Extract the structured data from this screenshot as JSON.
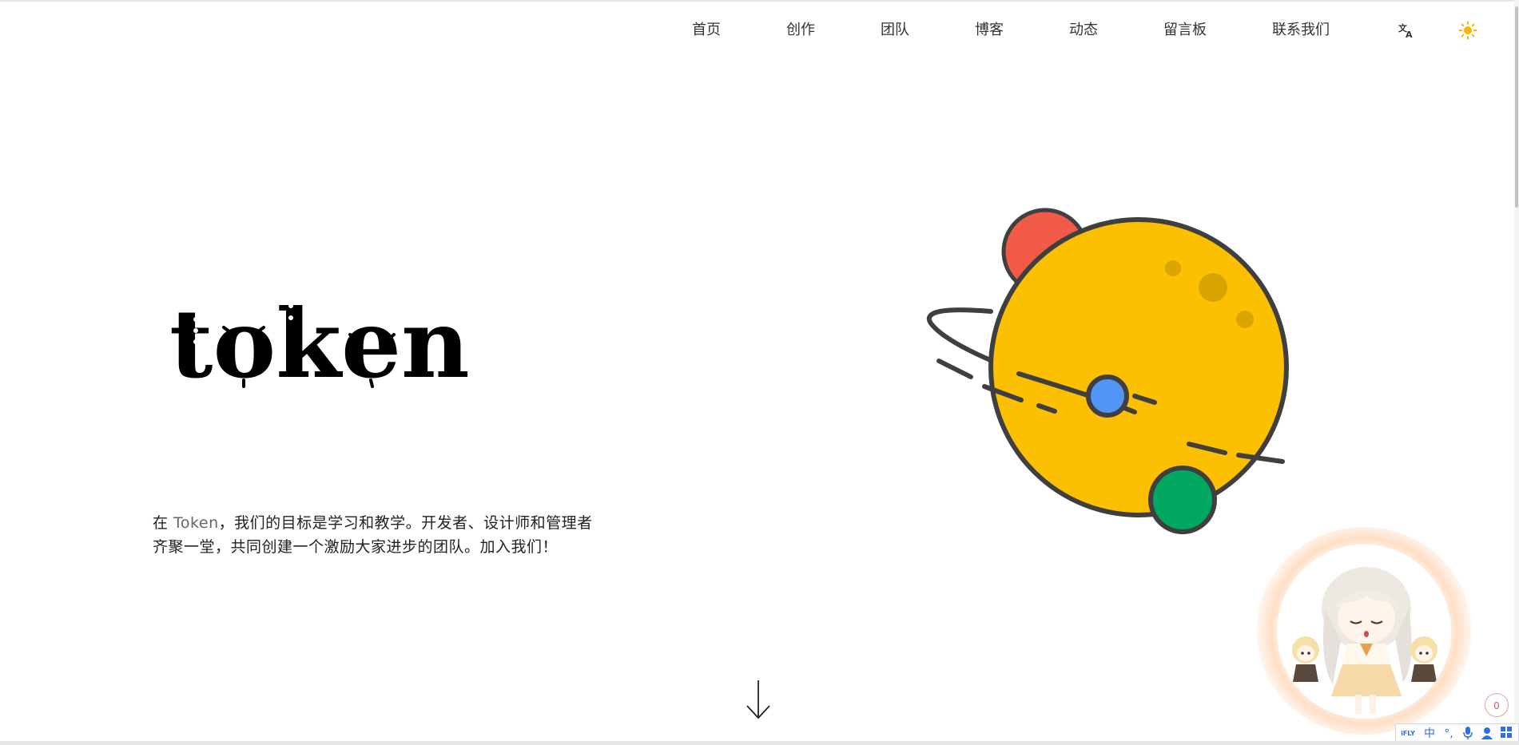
{
  "nav": {
    "items": [
      {
        "label": "首页"
      },
      {
        "label": "创作"
      },
      {
        "label": "团队"
      },
      {
        "label": "博客"
      },
      {
        "label": "动态"
      },
      {
        "label": "留言板"
      },
      {
        "label": "联系我们"
      }
    ],
    "language_icon": "translate-icon",
    "theme_icon": "sun-icon"
  },
  "hero": {
    "logo_text": "token",
    "intro_prefix": "在 ",
    "intro_brand": "Token",
    "intro_line1_rest": "，我们的目标是学习和教学。开发者、设计师和管理者",
    "intro_line2": "齐聚一堂，共同创建一个激励大家进步的团队。加入我们！"
  },
  "mascot": {
    "counter": "0"
  },
  "ime": {
    "logo": "iFLY",
    "mode": "中",
    "punct": "°,",
    "mic_icon": "microphone-icon",
    "user_icon": "user-icon",
    "grid_icon": "grid-icon"
  },
  "colors": {
    "planet_yellow": "#FDC000",
    "planet_red": "#F05A46",
    "planet_blue": "#5196F6",
    "planet_green": "#00A862",
    "outline": "#3F3F3F",
    "sun_icon": "#F7B500"
  }
}
